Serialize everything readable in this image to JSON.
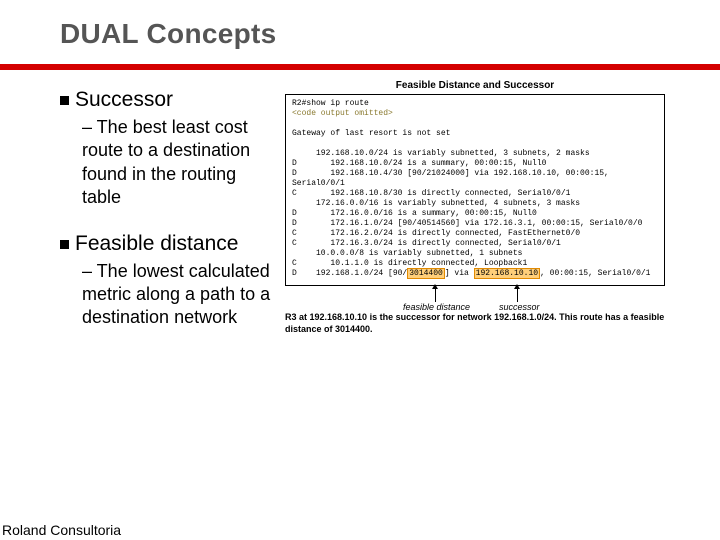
{
  "slide": {
    "title": "DUAL Concepts",
    "bullets": [
      {
        "label": "Successor",
        "sub_prefix": "– The ",
        "sub_rest": "best least cost route to a destination found in the routing table"
      },
      {
        "label": "Feasible distance",
        "sub_prefix": "– The ",
        "sub_rest": "lowest calculated metric along a path to a destination network"
      }
    ],
    "footer": "Roland Consultoria"
  },
  "figure": {
    "caption": "Feasible Distance and Successor",
    "cli": {
      "prompt": "R2#show ip route",
      "omitted": "<code output omitted>",
      "gateway": "Gateway of last resort is not set",
      "lines": [
        "     192.168.10.0/24 is variably subnetted, 3 subnets, 2 masks",
        "D       192.168.10.0/24 is a summary, 00:00:15, Null0",
        "D       192.168.10.4/30 [90/21024000] via 192.168.10.10, 00:00:15,",
        "Serial0/0/1",
        "C       192.168.10.8/30 is directly connected, Serial0/0/1",
        "     172.16.0.0/16 is variably subnetted, 4 subnets, 3 masks",
        "D       172.16.0.0/16 is a summary, 00:00:15, Null0",
        "D       172.16.1.0/24 [90/40514560] via 172.16.3.1, 00:00:15, Serial0/0/0",
        "C       172.16.2.0/24 is directly connected, FastEthernet0/0",
        "C       172.16.3.0/24 is directly connected, Serial0/0/1",
        "     10.0.0.0/8 is variably subnetted, 1 subnets",
        "C       10.1.1.0 is directly connected, Loopback1"
      ],
      "last_prefix": "D    192.168.1.0/24 [90/",
      "last_hl1": "3014400",
      "last_mid": "] via ",
      "last_hl2": "192.168.10.10",
      "last_suffix": ", 00:00:15, Serial0/0/1"
    },
    "labels": {
      "fd": "feasible distance",
      "succ": "successor"
    },
    "note": "R3 at 192.168.10.10 is the successor for network 192.168.1.0/24. This route has a feasible distance of 3014400."
  }
}
